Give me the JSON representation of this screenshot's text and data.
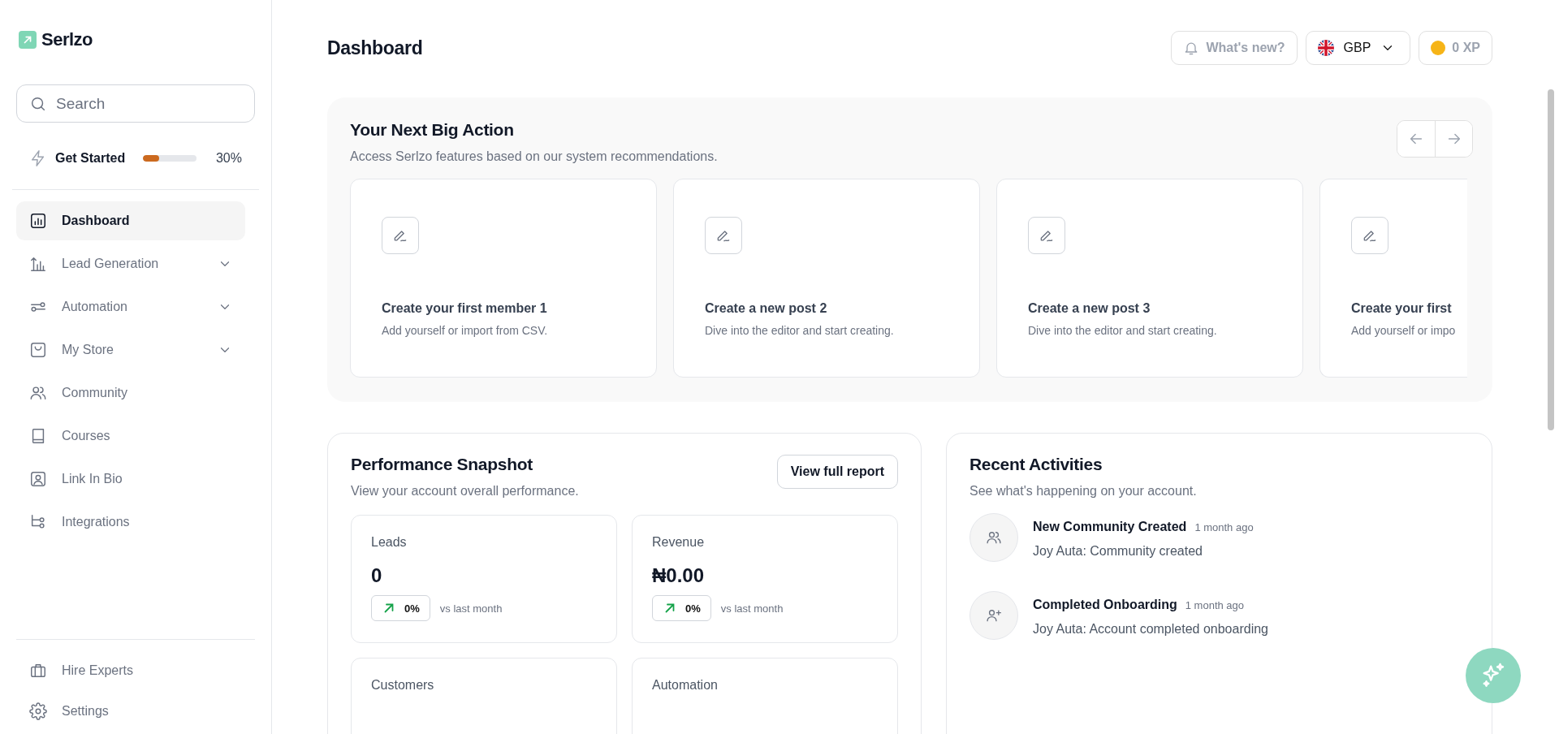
{
  "brand": {
    "name": "Serlzo"
  },
  "search": {
    "placeholder": "Search"
  },
  "get_started": {
    "label": "Get Started",
    "level": 0.3,
    "percent": "30%"
  },
  "nav": [
    {
      "label": "Dashboard",
      "selected": true,
      "has_submenu": false
    },
    {
      "label": "Lead Generation",
      "selected": false,
      "has_submenu": true
    },
    {
      "label": "Automation",
      "selected": false,
      "has_submenu": true
    },
    {
      "label": "My Store",
      "selected": false,
      "has_submenu": true
    },
    {
      "label": "Community",
      "selected": false,
      "has_submenu": false
    },
    {
      "label": "Courses",
      "selected": false,
      "has_submenu": false
    },
    {
      "label": "Link In Bio",
      "selected": false,
      "has_submenu": false
    },
    {
      "label": "Integrations",
      "selected": false,
      "has_submenu": false
    }
  ],
  "footer_nav": [
    {
      "label": "Hire Experts"
    },
    {
      "label": "Settings"
    }
  ],
  "header": {
    "title": "Dashboard",
    "whats_new": "What's new?",
    "currency": "GBP",
    "xp": "0 XP"
  },
  "next_action": {
    "title": "Your Next Big Action",
    "subtitle": "Access Serlzo features based on our system recommendations.",
    "cards": [
      {
        "title": "Create your first member 1",
        "description": "Add yourself or import from CSV."
      },
      {
        "title": "Create a new post 2",
        "description": "Dive into the editor and start creating."
      },
      {
        "title": "Create a new post 3",
        "description": "Dive into the editor and start creating."
      },
      {
        "title": "Create your first",
        "description": "Add yourself or impo"
      }
    ]
  },
  "performance": {
    "title": "Performance Snapshot",
    "subtitle": "View your account overall performance.",
    "report_button": "View full report",
    "metrics": [
      {
        "label": "Leads",
        "value": "0",
        "change": "0%",
        "comparison": "vs last month"
      },
      {
        "label": "Revenue",
        "value": "₦0.00",
        "change": "0%",
        "comparison": "vs last month"
      },
      {
        "label": "Customers"
      },
      {
        "label": "Automation"
      }
    ]
  },
  "recent": {
    "title": "Recent Activities",
    "subtitle": "See what's happening on your account.",
    "items": [
      {
        "title": "New Community Created",
        "time": "1 month ago",
        "detail": "Joy Auta: Community created"
      },
      {
        "title": "Completed Onboarding",
        "time": "1 month ago",
        "detail": "Joy Auta: Account completed onboarding"
      }
    ]
  }
}
